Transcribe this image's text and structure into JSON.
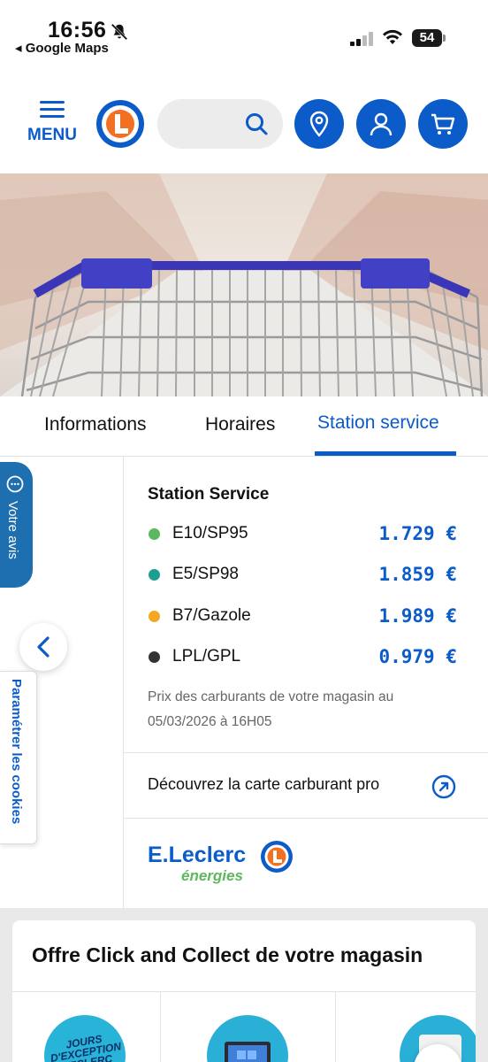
{
  "status_bar": {
    "time": "16:56",
    "back_app": "◂ Google Maps",
    "battery": "54"
  },
  "header": {
    "menu_label": "MENU",
    "brand_color": "#0b5cc9"
  },
  "tabs": [
    {
      "label": "Informations",
      "active": false
    },
    {
      "label": "Horaires",
      "active": false
    },
    {
      "label": "Station service",
      "active": true
    }
  ],
  "side": {
    "feedback_label": "Votre avis",
    "cookies_label": "Paramétrer les cookies"
  },
  "station": {
    "title": "Station Service",
    "fuels": [
      {
        "name": "E10/SP95",
        "price": "1.729 €",
        "color": "#5cb85c"
      },
      {
        "name": "E5/SP98",
        "price": "1.859 €",
        "color": "#1e9e8e"
      },
      {
        "name": "B7/Gazole",
        "price": "1.989 €",
        "color": "#f5a623"
      },
      {
        "name": "LPL/GPL",
        "price": "0.979 €",
        "color": "#333333"
      }
    ],
    "note": "Prix des carburants de votre magasin au 05/03/2026 à 16H05",
    "pro_link": "Découvrez la carte carburant pro",
    "logo_brand": "E.Leclerc",
    "logo_sub": "énergies"
  },
  "click_collect": {
    "title": "Offre Click and Collect de votre magasin",
    "tiles": [
      {
        "label": "JOURS D'EXCEPTION LECLERC"
      },
      {
        "label": "laptop"
      },
      {
        "label": "washing-machine"
      }
    ]
  }
}
